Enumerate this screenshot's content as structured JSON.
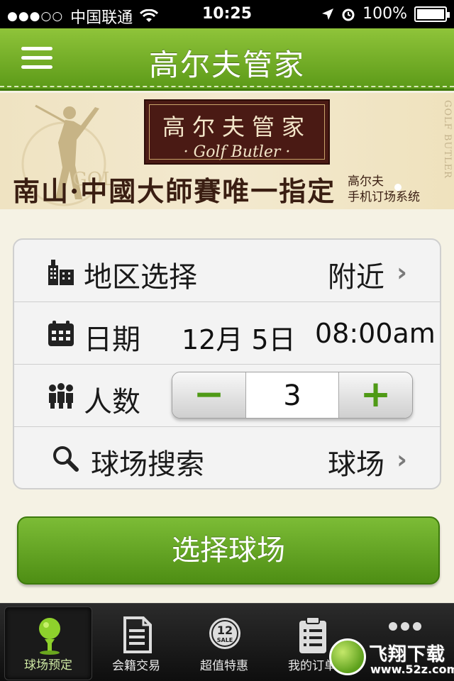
{
  "status_bar": {
    "carrier": "中国联通",
    "signal": "●●●○○",
    "time": "10:25",
    "battery": "100%"
  },
  "nav": {
    "title": "高尔夫管家",
    "menu_icon": "hamburger-menu-icon"
  },
  "banner": {
    "logo_cn": "高尔夫管家",
    "logo_en": "· Golf Butler ·",
    "slogan": "南山·中國大師賽唯一指定",
    "sub_line1": "高尔夫",
    "sub_line2": "手机订场系统",
    "side_text": "GOLF BUTLER"
  },
  "form": {
    "region": {
      "label": "地区选择",
      "value": "附近",
      "icon": "building-icon"
    },
    "date": {
      "label": "日期",
      "date": "12月 5日",
      "time": "08:00am",
      "icon": "calendar-icon"
    },
    "people": {
      "label": "人数",
      "value": "3",
      "minus": "−",
      "plus": "+",
      "icon": "people-icon"
    },
    "course_search": {
      "label": "球场搜索",
      "value": "球场",
      "icon": "search-icon"
    }
  },
  "submit": {
    "label": "选择球场"
  },
  "tabs": [
    {
      "label": "球场预定",
      "icon": "golf-ball-tee-icon",
      "active": true
    },
    {
      "label": "会籍交易",
      "icon": "document-icon",
      "active": false
    },
    {
      "label": "超值特惠",
      "icon": "sale-badge-icon",
      "active": false,
      "badge_num": "12",
      "badge_text": "SALE"
    },
    {
      "label": "我的订单",
      "icon": "clipboard-list-icon",
      "active": false
    },
    {
      "label": "",
      "icon": "more-dots-icon",
      "active": false
    }
  ],
  "watermark": {
    "text": "飞翔下载",
    "url": "www.52z.com"
  },
  "colors": {
    "nav_green": "#6fae24",
    "button_green": "#5a9c1c",
    "banner_brown": "#4a1a14",
    "tab_bar": "#1a1a1a"
  }
}
